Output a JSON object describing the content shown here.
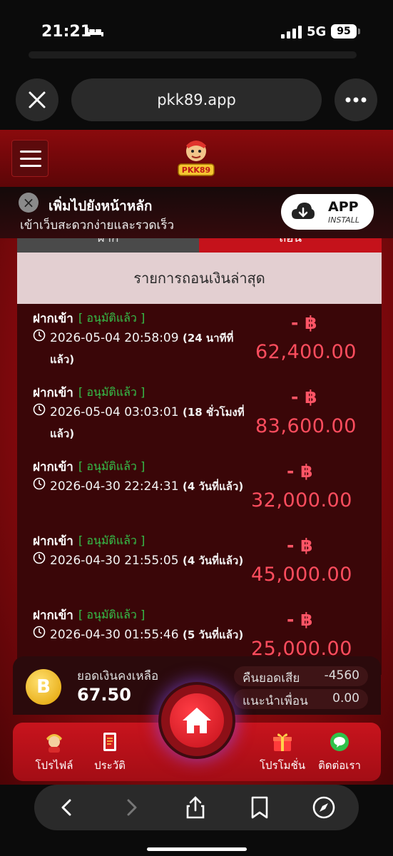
{
  "status_bar": {
    "time": "21:21",
    "network": "5G",
    "battery": "95"
  },
  "browser": {
    "url": "pkk89.app"
  },
  "site": {
    "logo_text": "PKK89",
    "add_to_home": {
      "title": "เพิ่มไปยังหน้าหลัก",
      "subtitle": "เข้าเว็บสะดวกง่ายและรวดเร็ว",
      "app_label": "APP",
      "install_label": "INSTALL"
    },
    "tabs": [
      {
        "label": "ฝาก"
      },
      {
        "label": "ถอน"
      }
    ],
    "panel_title": "รายการถอนเงินล่าสุด",
    "transactions": [
      {
        "title": "ฝากเข้า",
        "status": "[ อนุมัติแล้ว ]",
        "datetime": "2026-05-04 20:58:09",
        "ago": "(24 นาทีที่แล้ว)",
        "sign": "- ฿",
        "amount": "62,400.00"
      },
      {
        "title": "ฝากเข้า",
        "status": "[ อนุมัติแล้ว ]",
        "datetime": "2026-05-04 03:03:01",
        "ago": "(18 ชั่วโมงที่แล้ว)",
        "sign": "- ฿",
        "amount": "83,600.00"
      },
      {
        "title": "ฝากเข้า",
        "status": "[ อนุมัติแล้ว ]",
        "datetime": "2026-04-30 22:24:31",
        "ago": "(4 วันที่แล้ว)",
        "sign": "- ฿",
        "amount": "32,000.00"
      },
      {
        "title": "ฝากเข้า",
        "status": "[ อนุมัติแล้ว ]",
        "datetime": "2026-04-30 21:55:05",
        "ago": "(4 วันที่แล้ว)",
        "sign": "- ฿",
        "amount": "45,000.00"
      },
      {
        "title": "ฝากเข้า",
        "status": "[ อนุมัติแล้ว ]",
        "datetime": "2026-04-30 01:55:46",
        "ago": "(5 วันที่แล้ว)",
        "sign": "- ฿",
        "amount": "25,000.00"
      }
    ],
    "balance": {
      "label": "ยอดเงินคงเหลือ",
      "value": "67.50",
      "coin_symbol": "B",
      "cashback_label": "คืนยอดเสีย",
      "cashback_value": "-4560",
      "referral_label": "แนะนำเพื่อน",
      "referral_value": "0.00"
    },
    "nav": [
      {
        "label": "โปรไฟล์"
      },
      {
        "label": "ประวัติ"
      },
      {
        "label": "โปรโมชั่น"
      },
      {
        "label": "ติดต่อเรา"
      }
    ]
  },
  "colors": {
    "brand_red": "#c5121b",
    "approved_green": "#35c04a",
    "amount_red": "#ff4d5e"
  }
}
